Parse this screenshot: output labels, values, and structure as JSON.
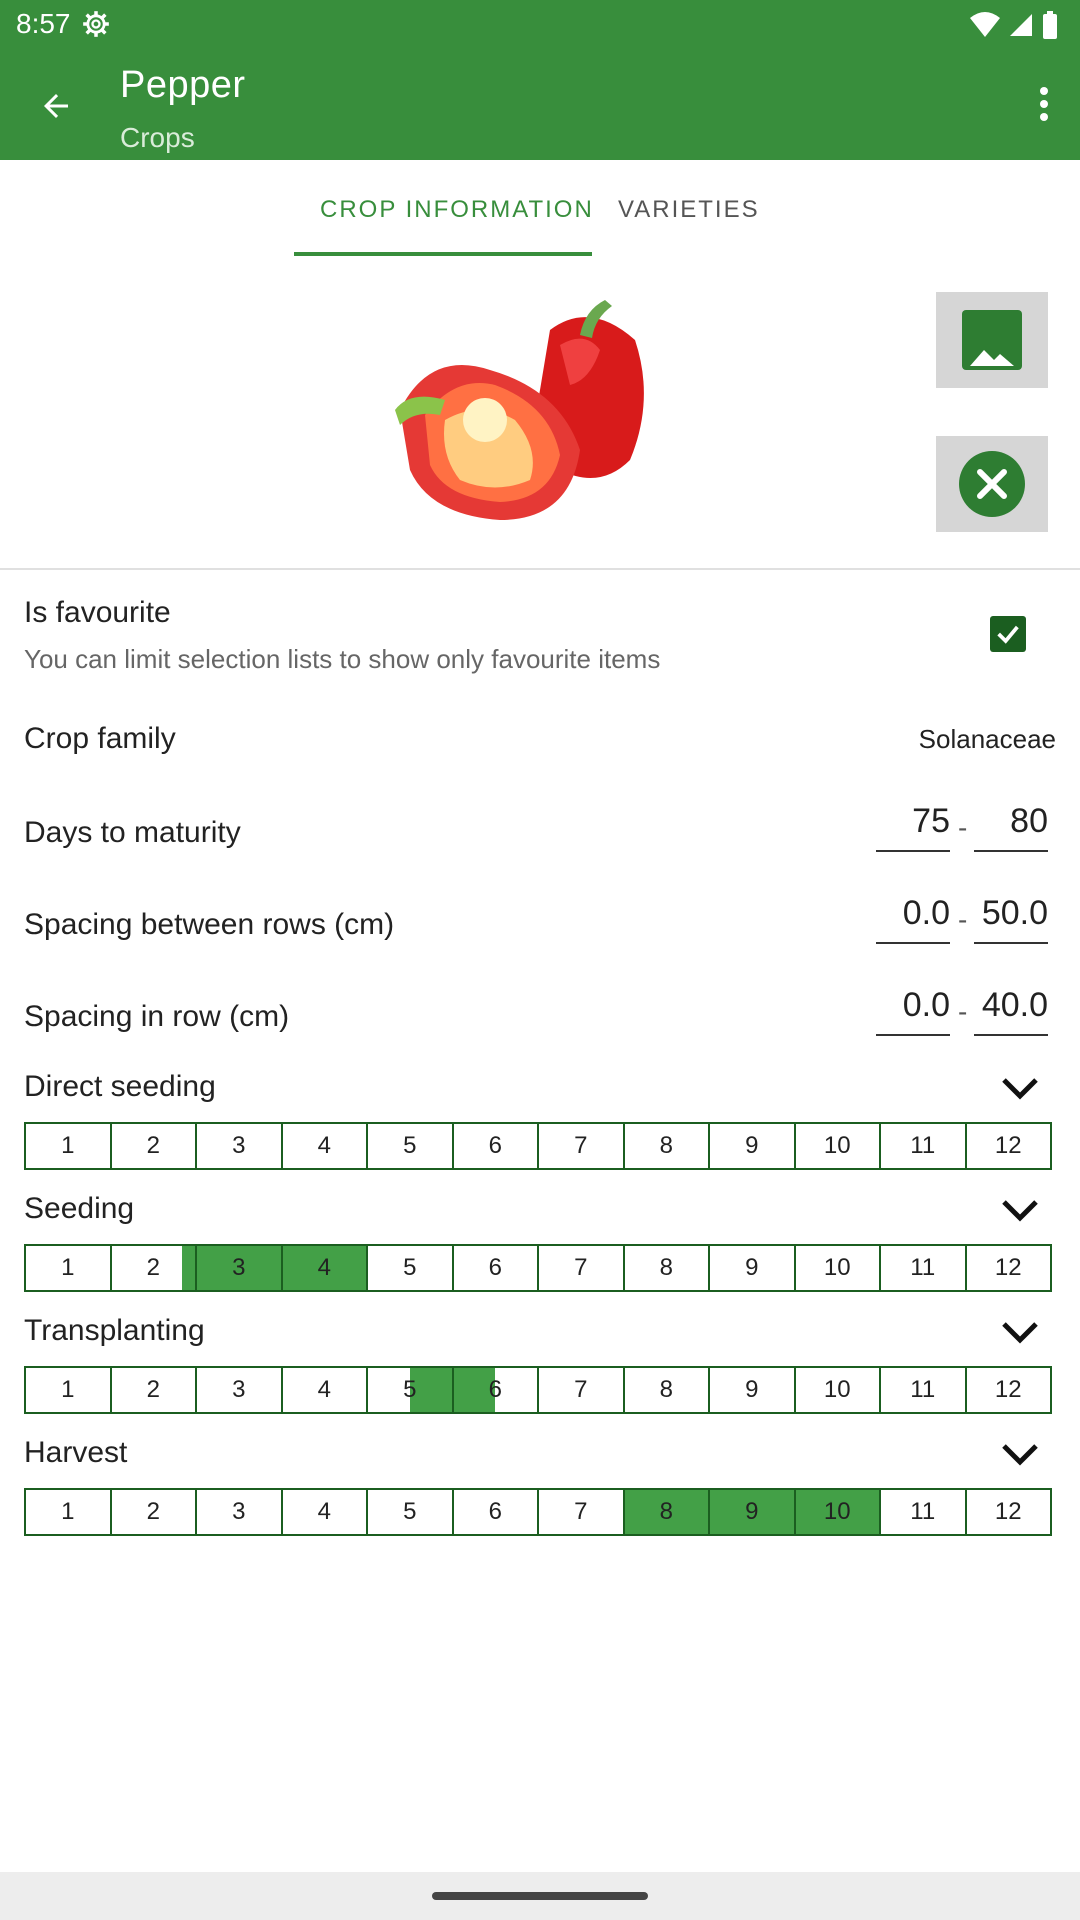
{
  "status_bar": {
    "time": "8:57"
  },
  "app_bar": {
    "title": "Pepper",
    "subtitle": "Crops"
  },
  "tabs": [
    {
      "label": "CROP INFORMATION",
      "selected": true
    },
    {
      "label": "VARIETIES",
      "selected": false
    }
  ],
  "favourite": {
    "title": "Is favourite",
    "subtitle": "You can limit selection lists to show only favourite items",
    "checked": true
  },
  "crop_family": {
    "label": "Crop family",
    "value": "Solanaceae"
  },
  "days_to_maturity": {
    "label": "Days to maturity",
    "min": "75",
    "max": "80"
  },
  "spacing_rows": {
    "label": "Spacing between rows (cm)",
    "min": "0.0",
    "max": "50.0"
  },
  "spacing_in_row": {
    "label": "Spacing in row (cm)",
    "min": "0.0",
    "max": "40.0"
  },
  "separator": "-",
  "colors": {
    "primary": "#388e3c",
    "fill": "#43a047",
    "border": "#1b5e20"
  },
  "months": [
    "1",
    "2",
    "3",
    "4",
    "5",
    "6",
    "7",
    "8",
    "9",
    "10",
    "11",
    "12"
  ],
  "calendars": [
    {
      "key": "direct_seeding",
      "label": "Direct seeding",
      "filled": []
    },
    {
      "key": "seeding",
      "label": "Seeding",
      "filled": [
        [
          2,
          0.85,
          1.0
        ],
        [
          3,
          0,
          1
        ],
        [
          4,
          0,
          1
        ]
      ]
    },
    {
      "key": "transplanting",
      "label": "Transplanting",
      "filled": [
        [
          5,
          0.5,
          1.0
        ],
        [
          6,
          0,
          0.5
        ]
      ]
    },
    {
      "key": "harvest",
      "label": "Harvest",
      "filled": [
        [
          8,
          0,
          1
        ],
        [
          9,
          0,
          1
        ],
        [
          10,
          0,
          1
        ]
      ]
    }
  ]
}
